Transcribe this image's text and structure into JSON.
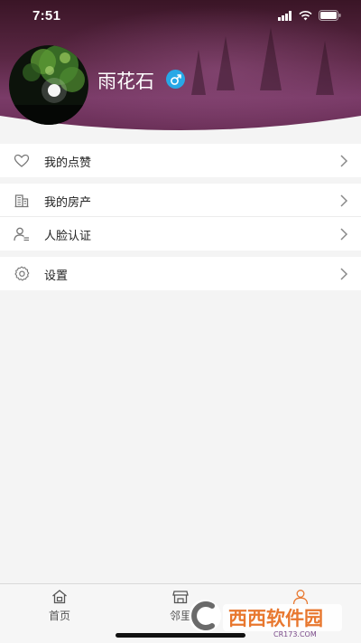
{
  "status_bar": {
    "time": "7:51"
  },
  "profile": {
    "username": "雨花石",
    "gender_symbol": "♂"
  },
  "menu": {
    "group1": [
      {
        "label": "我的点赞",
        "icon": "heart-icon"
      }
    ],
    "group2": [
      {
        "label": "我的房产",
        "icon": "building-icon"
      },
      {
        "label": "人脸认证",
        "icon": "person-id-icon"
      }
    ],
    "group3": [
      {
        "label": "设置",
        "icon": "gear-icon"
      }
    ]
  },
  "tabbar": {
    "tabs": [
      {
        "label": "首页",
        "icon": "home-icon"
      },
      {
        "label": "邻里",
        "icon": "shop-icon"
      },
      {
        "label": "",
        "icon": "person-icon"
      }
    ]
  },
  "watermark": {
    "brand": "西西软件园",
    "url": "CR173.COM"
  },
  "colors": {
    "accent": "#e8772e",
    "header_dark": "#3d1a2a",
    "header_purple": "#7a3a6a",
    "gender_badge": "#28a8e6"
  }
}
